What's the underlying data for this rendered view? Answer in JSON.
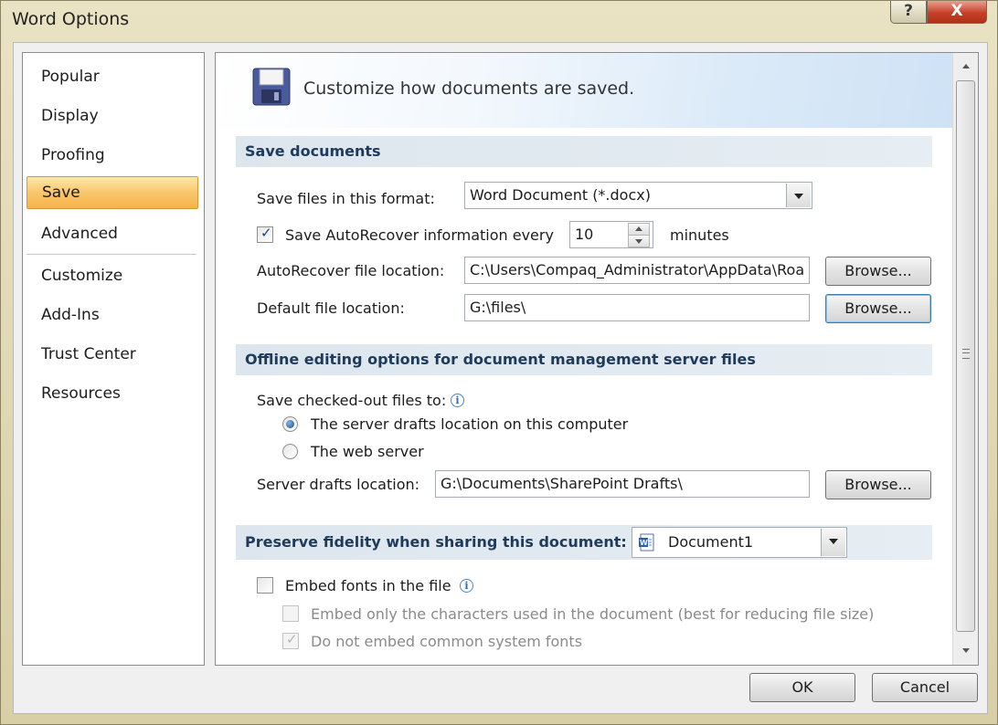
{
  "window": {
    "title": "Word Options",
    "help_label": "?",
    "close_label": "X"
  },
  "sidebar": {
    "items": [
      {
        "label": "Popular"
      },
      {
        "label": "Display"
      },
      {
        "label": "Proofing"
      },
      {
        "label": "Save",
        "selected": true
      },
      {
        "label": "Advanced"
      },
      {
        "label": "Customize"
      },
      {
        "label": "Add-Ins"
      },
      {
        "label": "Trust Center"
      },
      {
        "label": "Resources"
      }
    ]
  },
  "header": {
    "text": "Customize how documents are saved."
  },
  "save_documents": {
    "heading": "Save documents",
    "format_label": "Save files in this format:",
    "format_value": "Word Document (*.docx)",
    "autorecover_label": "Save AutoRecover information every",
    "autorecover_checked": true,
    "autorecover_minutes": "10",
    "minutes_label": "minutes",
    "autorecover_location_label": "AutoRecover file location:",
    "autorecover_location_value": "C:\\Users\\Compaq_Administrator\\AppData\\Roa",
    "default_location_label": "Default file location:",
    "default_location_value": "G:\\files\\",
    "browse_label": "Browse..."
  },
  "offline": {
    "heading": "Offline editing options for document management server files",
    "save_to_label": "Save checked-out files to:",
    "option_server_drafts": "The server drafts location on this computer",
    "option_web_server": "The web server",
    "selected_option": "server_drafts",
    "server_drafts_label": "Server drafts location:",
    "server_drafts_value": "G:\\Documents\\SharePoint Drafts\\",
    "browse_label": "Browse..."
  },
  "fidelity": {
    "heading": "Preserve fidelity when sharing this document:",
    "document_value": "Document1",
    "embed_fonts_label": "Embed fonts in the file",
    "embed_fonts_checked": false,
    "embed_chars_label": "Embed only the characters used in the document (best for reducing file size)",
    "embed_chars_checked": false,
    "no_common_fonts_label": "Do not embed common system fonts",
    "no_common_fonts_checked": true
  },
  "footer": {
    "ok_label": "OK",
    "cancel_label": "Cancel"
  },
  "colors": {
    "selected_nav": "#f9c66c",
    "section_heading": "#1f3b5b",
    "section_bg": "#dde6ee"
  },
  "icons": {
    "banner": "floppy-disk-icon",
    "document": "word-document-icon",
    "info": "info-icon"
  }
}
